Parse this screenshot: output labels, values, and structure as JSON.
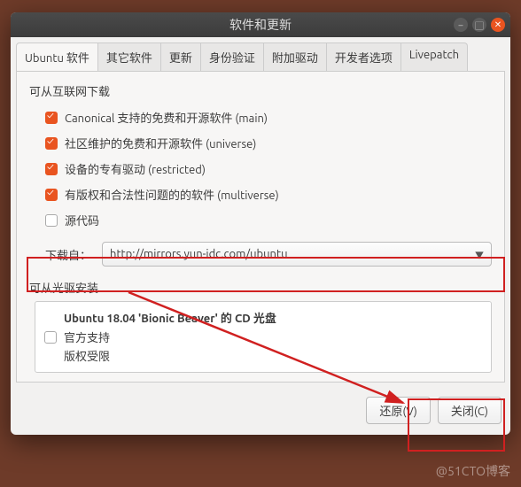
{
  "window": {
    "title": "软件和更新"
  },
  "tabs": [
    {
      "label": "Ubuntu 软件",
      "active": true
    },
    {
      "label": "其它软件"
    },
    {
      "label": "更新"
    },
    {
      "label": "身份验证"
    },
    {
      "label": "附加驱动"
    },
    {
      "label": "开发者选项"
    },
    {
      "label": "Livepatch"
    }
  ],
  "internet": {
    "title": "可从互联网下载",
    "options": [
      {
        "label": "Canonical 支持的免费和开源软件 (main)",
        "checked": true
      },
      {
        "label": "社区维护的免费和开源软件 (universe)",
        "checked": true
      },
      {
        "label": "设备的专有驱动 (restricted)",
        "checked": true
      },
      {
        "label": "有版权和合法性问题的的软件 (multiverse)",
        "checked": true
      },
      {
        "label": "源代码",
        "checked": false
      }
    ],
    "download_label": "下载自：",
    "download_value": "http://mirrors.yun-idc.com/ubuntu"
  },
  "cdrom": {
    "title": "可从光驱安装",
    "disc_title": "Ubuntu 18.04 'Bionic Beaver' 的 CD 光盘",
    "lines": [
      {
        "label": "官方支持",
        "checked": false
      },
      {
        "label": "版权受限"
      }
    ]
  },
  "footer": {
    "revert": "还原(V)",
    "close": "关闭(C)"
  },
  "watermark": "@51CTO博客"
}
